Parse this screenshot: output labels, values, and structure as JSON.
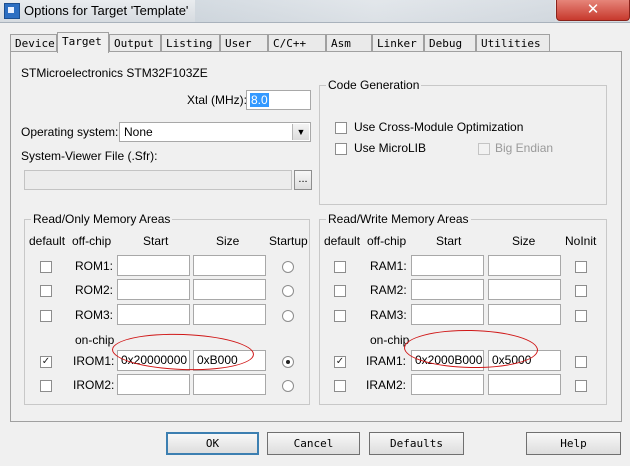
{
  "window": {
    "title": "Options for Target 'Template'",
    "close_glyph": "✕"
  },
  "tabs": [
    {
      "label": "Device",
      "active": false
    },
    {
      "label": "Target",
      "active": true
    },
    {
      "label": "Output",
      "active": false
    },
    {
      "label": "Listing",
      "active": false
    },
    {
      "label": "User",
      "active": false
    },
    {
      "label": "C/C++",
      "active": false
    },
    {
      "label": "Asm",
      "active": false
    },
    {
      "label": "Linker",
      "active": false
    },
    {
      "label": "Debug",
      "active": false
    },
    {
      "label": "Utilities",
      "active": false
    }
  ],
  "target": {
    "device_name": "STMicroelectronics STM32F103ZE",
    "xtal_label": "Xtal (MHz):",
    "xtal_value": "8.0",
    "os_label": "Operating system:",
    "os_value": "None",
    "sfr_label": "System-Viewer File (.Sfr):",
    "sfr_value": "",
    "browse_label": "..."
  },
  "code_generation": {
    "title": "Code Generation",
    "cross_module_label": "Use Cross-Module Optimization",
    "cross_module_checked": false,
    "microlib_label": "Use MicroLIB",
    "microlib_checked": false,
    "big_endian_label": "Big Endian",
    "big_endian_checked": false
  },
  "ro_memory": {
    "title": "Read/Only Memory Areas",
    "headers": {
      "default": "default",
      "offchip": "off-chip",
      "start": "Start",
      "size": "Size",
      "startup": "Startup"
    },
    "onchip_label": "on-chip",
    "rows": [
      {
        "name": "ROM1:",
        "default": false,
        "start": "",
        "size": "",
        "startup": false
      },
      {
        "name": "ROM2:",
        "default": false,
        "start": "",
        "size": "",
        "startup": false
      },
      {
        "name": "ROM3:",
        "default": false,
        "start": "",
        "size": "",
        "startup": false
      },
      {
        "name": "IROM1:",
        "default": true,
        "start": "0x20000000",
        "size": "0xB000",
        "startup": true
      },
      {
        "name": "IROM2:",
        "default": false,
        "start": "",
        "size": "",
        "startup": false
      }
    ]
  },
  "rw_memory": {
    "title": "Read/Write Memory Areas",
    "headers": {
      "default": "default",
      "offchip": "off-chip",
      "start": "Start",
      "size": "Size",
      "noinit": "NoInit"
    },
    "onchip_label": "on-chip",
    "rows": [
      {
        "name": "RAM1:",
        "default": false,
        "start": "",
        "size": "",
        "noinit": false
      },
      {
        "name": "RAM2:",
        "default": false,
        "start": "",
        "size": "",
        "noinit": false
      },
      {
        "name": "RAM3:",
        "default": false,
        "start": "",
        "size": "",
        "noinit": false
      },
      {
        "name": "IRAM1:",
        "default": true,
        "start": "0x2000B000",
        "size": "0x5000",
        "noinit": false
      },
      {
        "name": "IRAM2:",
        "default": false,
        "start": "",
        "size": "",
        "noinit": false
      }
    ]
  },
  "buttons": {
    "ok": "OK",
    "cancel": "Cancel",
    "defaults": "Defaults",
    "help": "Help"
  },
  "check_glyph": "✓",
  "colors": {
    "annotation": "#d01818",
    "selection": "#3399ff",
    "close": "#c7392d"
  }
}
